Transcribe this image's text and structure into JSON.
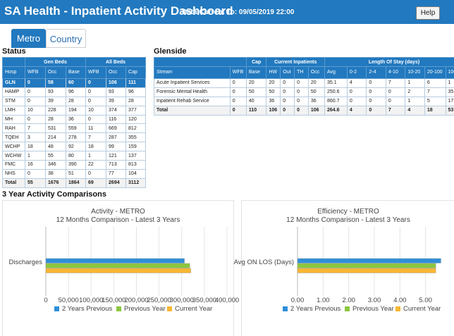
{
  "header": {
    "title": "SA Health - Inpatient Activity Dashboard",
    "data_current": "Data Current To: 09/05/2019 22:00",
    "help_label": "Help"
  },
  "tabs": [
    {
      "label": "Metro",
      "active": true
    },
    {
      "label": "Country",
      "active": false
    }
  ],
  "status": {
    "title": "Status",
    "group_headers": [
      "Gen Beds",
      "All Beds"
    ],
    "columns": [
      "Hosp",
      "WFB",
      "Occ",
      "Base",
      "WFB",
      "Occ",
      "Cap"
    ],
    "rows": [
      [
        "GLN",
        "0",
        "58",
        "60",
        "0",
        "106",
        "111"
      ],
      [
        "HAMP",
        "0",
        "93",
        "96",
        "0",
        "93",
        "96"
      ],
      [
        "STM",
        "0",
        "39",
        "28",
        "0",
        "39",
        "28"
      ],
      [
        "LMH",
        "10",
        "228",
        "194",
        "10",
        "374",
        "377"
      ],
      [
        "MH",
        "0",
        "28",
        "36",
        "0",
        "116",
        "120"
      ],
      [
        "RAH",
        "7",
        "531",
        "559",
        "11",
        "669",
        "812"
      ],
      [
        "TQEH",
        "3",
        "214",
        "278",
        "7",
        "287",
        "355"
      ],
      [
        "WCHP",
        "18",
        "48",
        "92",
        "18",
        "99",
        "159"
      ],
      [
        "WCHW",
        "1",
        "55",
        "80",
        "1",
        "121",
        "137"
      ],
      [
        "FMC",
        "16",
        "346",
        "390",
        "22",
        "713",
        "813"
      ],
      [
        "NHS",
        "0",
        "38",
        "51",
        "0",
        "77",
        "104"
      ]
    ],
    "highlight_row": 0,
    "total": [
      "Total",
      "55",
      "1676",
      "1864",
      "69",
      "2694",
      "3112"
    ]
  },
  "glenside": {
    "title": "Glenside",
    "group_headers": [
      "Cap",
      "Current Inpatients",
      "Length Of Stay (days)"
    ],
    "columns": [
      "Stream",
      "WFB",
      "Base",
      "HW",
      "Out",
      "TH",
      "Occ",
      "Avg",
      "0-2",
      "2-4",
      "4-10",
      "10-20",
      "20-100",
      "100+"
    ],
    "rows": [
      [
        "Acute Inpatient Services",
        "0",
        "20",
        "20",
        "0",
        "0",
        "20",
        "35.1",
        "4",
        "0",
        "7",
        "1",
        "6",
        "1"
      ],
      [
        "Forensic Mental Health",
        "0",
        "50",
        "50",
        "0",
        "0",
        "50",
        "250.6",
        "0",
        "0",
        "0",
        "2",
        "7",
        "35"
      ],
      [
        "Inpatient Rehab Service",
        "0",
        "40",
        "36",
        "0",
        "0",
        "36",
        "860.7",
        "0",
        "0",
        "0",
        "1",
        "5",
        "17"
      ]
    ],
    "total": [
      "Total",
      "0",
      "110",
      "106",
      "0",
      "0",
      "106",
      "264.6",
      "4",
      "0",
      "7",
      "4",
      "18",
      "53"
    ]
  },
  "comparisons": {
    "title": "3 Year Activity Comparisons"
  },
  "chart_data": [
    {
      "type": "bar",
      "orientation": "horizontal",
      "title": "Activity - METRO",
      "subtitle": "12 Months Comparison - Latest 3 Years",
      "categories": [
        "Discharges"
      ],
      "xlim": [
        0,
        400000
      ],
      "xticks": [
        0,
        50000,
        100000,
        150000,
        200000,
        250000,
        300000,
        350000,
        400000
      ],
      "xtick_labels": [
        "0",
        "50,000",
        "100,000",
        "150,000",
        "200,000",
        "250,000",
        "300,000",
        "350,000",
        "400,000"
      ],
      "series": [
        {
          "name": "2 Years Previous",
          "color": "#2e8fd9",
          "values": [
            306000
          ]
        },
        {
          "name": "Previous Year",
          "color": "#8dc63f",
          "values": [
            318000
          ]
        },
        {
          "name": "Current Year",
          "color": "#f9b732",
          "values": [
            320000
          ]
        }
      ],
      "legend": "bottom",
      "grid": true
    },
    {
      "type": "bar",
      "orientation": "horizontal",
      "title": "Efficiency - METRO",
      "subtitle": "12 Months Comparison - Latest 3 Years",
      "categories": [
        "Avg ON LOS (Days)"
      ],
      "xlim": [
        0,
        6
      ],
      "xticks": [
        0,
        1,
        2,
        3,
        4,
        5
      ],
      "xtick_labels": [
        "0.00",
        "1.00",
        "2.00",
        "3.00",
        "4.00",
        "5.00"
      ],
      "series": [
        {
          "name": "2 Years Previous",
          "color": "#2e8fd9",
          "values": [
            5.6
          ]
        },
        {
          "name": "Previous Year",
          "color": "#8dc63f",
          "values": [
            5.4
          ]
        },
        {
          "name": "Current Year",
          "color": "#f9b732",
          "values": [
            5.4
          ]
        }
      ],
      "legend": "bottom",
      "grid": true
    }
  ]
}
